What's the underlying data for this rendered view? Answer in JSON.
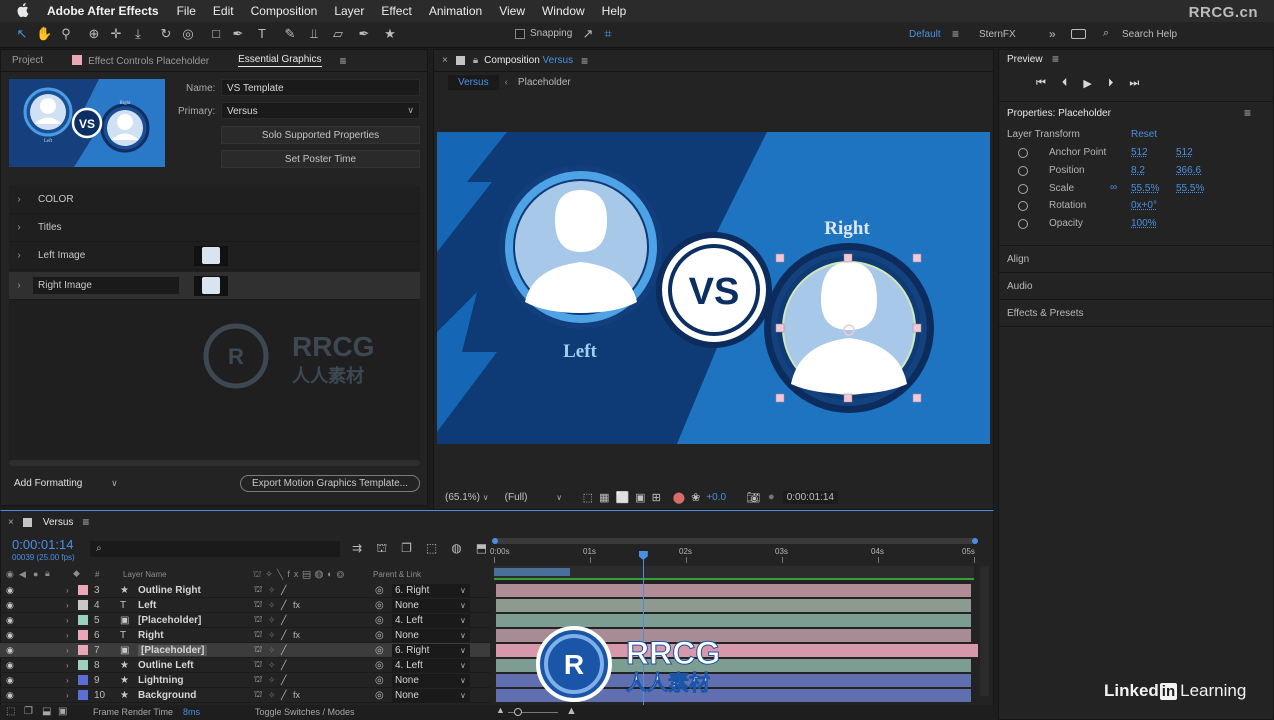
{
  "menubar": {
    "apple": "",
    "app_name": "Adobe After Effects",
    "items": [
      "File",
      "Edit",
      "Composition",
      "Layer",
      "Effect",
      "Animation",
      "View",
      "Window",
      "Help"
    ],
    "watermark": "RRCG.cn"
  },
  "toolbar": {
    "snapping_label": "Snapping",
    "workspace_default": "Default",
    "workspace_other": "SternFX",
    "search_help": "Search Help"
  },
  "left_panel": {
    "tabs": [
      "Project",
      "Effect Controls Placeholder",
      "Essential Graphics"
    ],
    "name_label": "Name:",
    "name_value": "VS Template",
    "primary_label": "Primary:",
    "primary_value": "Versus",
    "solo_button": "Solo Supported Properties",
    "poster_button": "Set Poster Time",
    "properties": [
      {
        "label": "COLOR",
        "has_image": false
      },
      {
        "label": "Titles",
        "has_image": false
      },
      {
        "label": "Left Image",
        "has_image": true
      },
      {
        "label": "Right Image",
        "has_image": true
      }
    ],
    "thumb_left": "Left",
    "thumb_right": "Right",
    "thumb_vs": "VS",
    "add_formatting": "Add Formatting",
    "export_button": "Export Motion Graphics Template..."
  },
  "comp_panel": {
    "tab_prefix": "Composition",
    "tab_name": "Versus",
    "breadcrumb_current": "Versus",
    "breadcrumb_other": "Placeholder",
    "left_label": "Left",
    "right_label": "Right",
    "vs_label": "VS",
    "zoom": "(65.1%)",
    "resolution": "(Full)",
    "exposure": "+0.0",
    "timecode": "0:00:01:14"
  },
  "right_panel": {
    "preview_title": "Preview",
    "properties_title": "Properties: Placeholder",
    "layer_transform": "Layer Transform",
    "reset": "Reset",
    "transform": [
      {
        "name": "Anchor Point",
        "v1": "512",
        "v2": "512"
      },
      {
        "name": "Position",
        "v1": "8.2",
        "v2": "366.6"
      },
      {
        "name": "Scale",
        "v1": "55.5%",
        "v2": "55.5%"
      },
      {
        "name": "Rotation",
        "v1": "0x+0°",
        "v2": ""
      },
      {
        "name": "Opacity",
        "v1": "100%",
        "v2": ""
      }
    ],
    "sections": [
      "Align",
      "Audio",
      "Effects & Presets"
    ]
  },
  "timeline": {
    "comp_name": "Versus",
    "current_time": "0:00:01:14",
    "fps_info": "00039 (25.00 fps)",
    "col_hash": "#",
    "col_layer_name": "Layer Name",
    "col_parent": "Parent & Link",
    "ruler": [
      "0:00s",
      "01s",
      "02s",
      "03s",
      "04s",
      "05s"
    ],
    "playhead_fraction": 0.31,
    "layers": [
      {
        "num": "3",
        "type": "star",
        "name": "Outline Right",
        "parent": "6. Right",
        "color": "#e8a8b8",
        "fx": false,
        "bar": "#b08c96"
      },
      {
        "num": "4",
        "type": "text",
        "name": "Left",
        "parent": "None",
        "color": "#c8c8c8",
        "fx": true,
        "bar": "#8c9a90"
      },
      {
        "num": "5",
        "type": "comp",
        "name": "[Placeholder]",
        "parent": "4. Left",
        "color": "#9ccfc0",
        "fx": false,
        "bar": "#7d9c92"
      },
      {
        "num": "6",
        "type": "text",
        "name": "Right",
        "parent": "None",
        "color": "#e8a8b8",
        "fx": true,
        "bar": "#a88c94"
      },
      {
        "num": "7",
        "type": "comp",
        "name": "[Placeholder]",
        "parent": "6. Right",
        "color": "#e8a8b8",
        "fx": false,
        "bar": "#d898ac",
        "selected": true
      },
      {
        "num": "8",
        "type": "star",
        "name": "Outline Left",
        "parent": "4. Left",
        "color": "#9ccfc0",
        "fx": false,
        "bar": "#7d9c92"
      },
      {
        "num": "9",
        "type": "star",
        "name": "Lightning",
        "parent": "None",
        "color": "#5a6fd0",
        "fx": false,
        "bar": "#5f6fb0"
      },
      {
        "num": "10",
        "type": "star",
        "name": "Background",
        "parent": "None",
        "color": "#5a6fd0",
        "fx": true,
        "bar": "#5f6fb0"
      }
    ],
    "frame_render_label": "Frame Render Time",
    "frame_render_value": "8ms",
    "toggle_label": "Toggle Switches / Modes"
  },
  "overlay": {
    "watermark_brand": "RRCG",
    "watermark_cn": "人人素材",
    "linkedin_left": "Linked",
    "linkedin_in": "in",
    "linkedin_right": "Learning"
  }
}
